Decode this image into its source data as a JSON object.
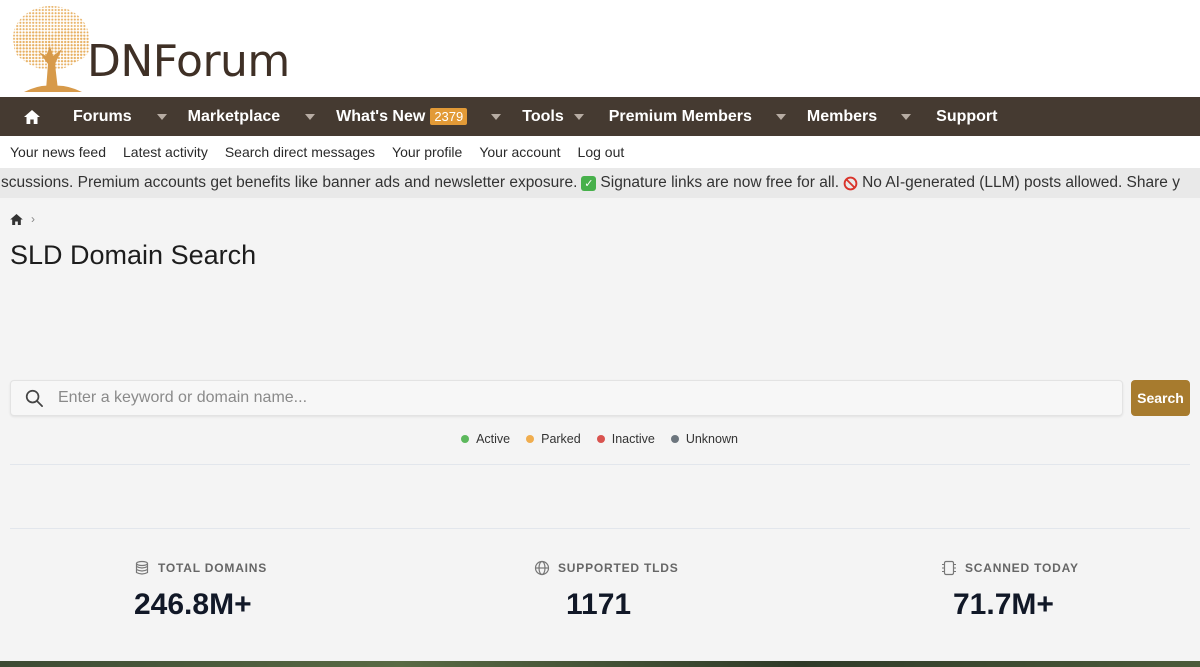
{
  "brand": {
    "logo_text": "DNForum"
  },
  "nav": {
    "items": [
      {
        "label": "Forums",
        "caret": true
      },
      {
        "label": "Marketplace",
        "caret": true
      },
      {
        "label": "What's New",
        "badge": "2379",
        "caret": true
      },
      {
        "label": "Tools",
        "caret": true
      },
      {
        "label": "Premium Members",
        "caret": true
      },
      {
        "label": "Members",
        "caret": true
      },
      {
        "label": "Support",
        "caret": false
      }
    ]
  },
  "subnav": {
    "items": [
      "Your news feed",
      "Latest activity",
      "Search direct messages",
      "Your profile",
      "Your account",
      "Log out"
    ]
  },
  "ticker": {
    "part1": "scussions. Premium accounts get benefits like banner ads and newsletter exposure.",
    "part2": "Signature links are now free for all.",
    "part3": "No AI-generated (LLM) posts allowed. Share y"
  },
  "page": {
    "title": "SLD Domain Search"
  },
  "search": {
    "placeholder": "Enter a keyword or domain name...",
    "button_label": "Search"
  },
  "legend": [
    {
      "label": "Active",
      "color": "#5cb85c"
    },
    {
      "label": "Parked",
      "color": "#f0ad4e"
    },
    {
      "label": "Inactive",
      "color": "#d9534f"
    },
    {
      "label": "Unknown",
      "color": "#6c757d"
    }
  ],
  "stats": [
    {
      "label": "TOTAL DOMAINS",
      "value": "246.8M+",
      "icon": "database-icon"
    },
    {
      "label": "SUPPORTED TLDS",
      "value": "1171",
      "icon": "globe-icon"
    },
    {
      "label": "SCANNED TODAY",
      "value": "71.7M+",
      "icon": "chip-icon"
    }
  ],
  "colors": {
    "nav_bg": "#453a31",
    "badge": "#e29a37",
    "search_button": "#a77b2e",
    "logo_text": "#3f3026"
  }
}
